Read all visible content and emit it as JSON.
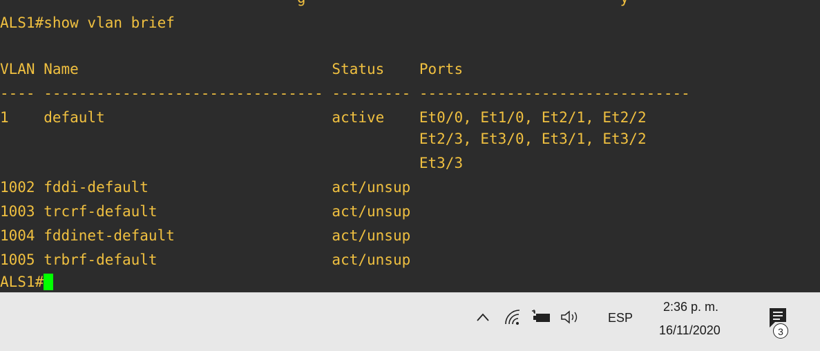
{
  "terminal": {
    "top_fragment": "                                  g                                    y",
    "command_line": "ALS1#show vlan brief",
    "header_line": "VLAN Name                             Status    Ports",
    "separator_line": "---- -------------------------------- --------- -------------------------------",
    "rows": [
      "1    default                          active    Et0/0, Et1/0, Et2/1, Et2/2",
      "                                                Et2/3, Et3/0, Et3/1, Et3/2",
      "                                                Et3/3",
      "1002 fddi-default                     act/unsup",
      "1003 trcrf-default                    act/unsup",
      "1004 fddinet-default                  act/unsup",
      "1005 trbrf-default                    act/unsup"
    ],
    "prompt": "ALS1#",
    "text_color": "#f0c040",
    "background_color": "#2c2c2c",
    "cursor_color": "#00ff00"
  },
  "taskbar": {
    "tray_icons": [
      "chevron-up-icon",
      "wifi-icon",
      "battery-icon",
      "speaker-icon"
    ],
    "language": "ESP",
    "time": "2:36 p. m.",
    "date": "16/11/2020",
    "notification_count": "3",
    "background_color": "#e8e8e8"
  }
}
